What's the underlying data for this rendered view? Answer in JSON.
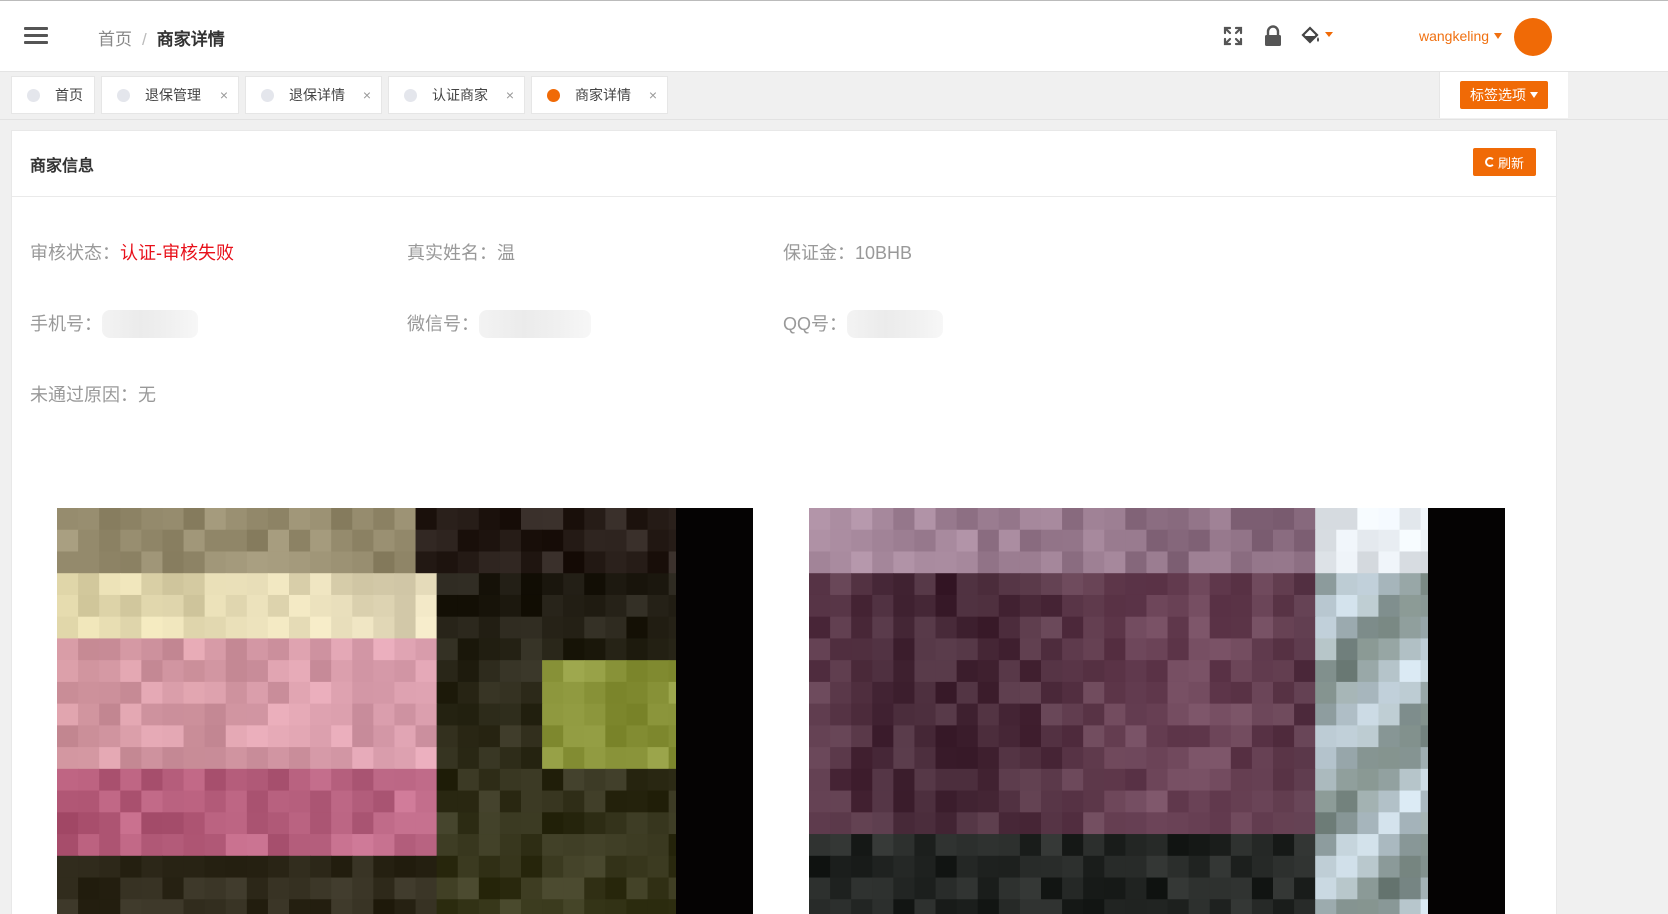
{
  "header": {
    "breadcrumb": [
      "首页",
      "商家详情"
    ],
    "breadcrumb_separator": "/",
    "icons": [
      "fullscreen-icon",
      "lock-icon",
      "theme-paint-icon"
    ],
    "username": "wangkeling"
  },
  "tabs": [
    {
      "label": "首页",
      "active": false,
      "closable": false
    },
    {
      "label": "退保管理",
      "active": false,
      "closable": true
    },
    {
      "label": "退保详情",
      "active": false,
      "closable": true
    },
    {
      "label": "认证商家",
      "active": false,
      "closable": true
    },
    {
      "label": "商家详情",
      "active": true,
      "closable": true
    }
  ],
  "tab_close_glyph": "×",
  "tab_options_label": "标签选项",
  "card": {
    "title": "商家信息",
    "refresh_label": "刷新"
  },
  "fields": {
    "status": {
      "label": "审核状态：",
      "value": "认证-审核失败"
    },
    "real_name": {
      "label": "真实姓名：",
      "value": "温"
    },
    "deposit": {
      "label": "保证金：",
      "value": "10BHB"
    },
    "phone": {
      "label": "手机号："
    },
    "wechat": {
      "label": "微信号："
    },
    "qq": {
      "label": "QQ号："
    },
    "reject_reason": {
      "label": "未通过原因：",
      "value": "无"
    }
  },
  "colors": {
    "accent": "#f06a06",
    "error": "#e8101a"
  }
}
